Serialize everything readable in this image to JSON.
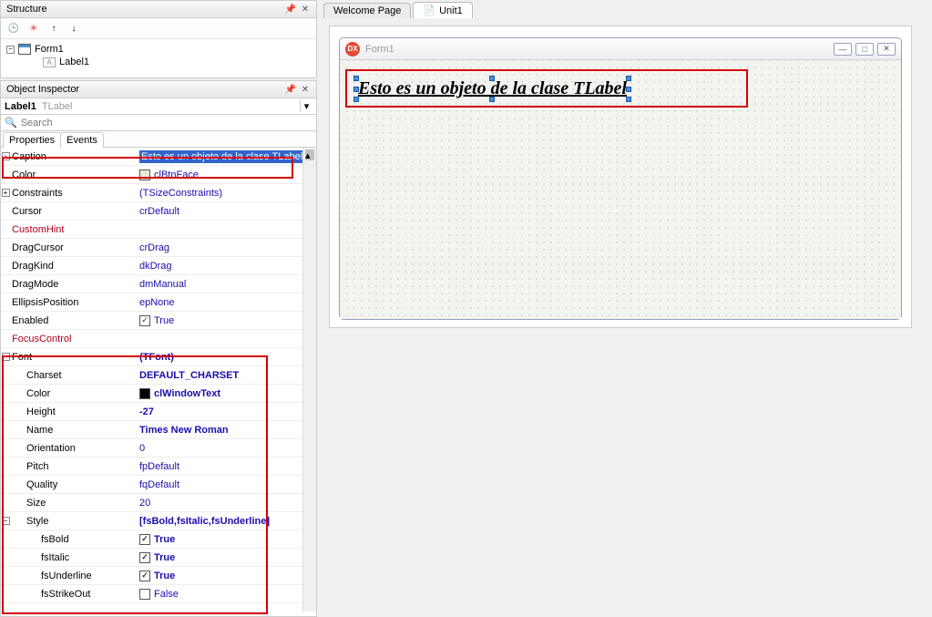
{
  "structure": {
    "title": "Structure",
    "toolbar_icons": [
      "t-blue",
      "x-red",
      "arrow-up",
      "arrow-down"
    ],
    "tree": {
      "form": "Form1",
      "label": "Label1"
    }
  },
  "inspector": {
    "title": "Object Inspector",
    "obj_name": "Label1",
    "obj_type": "TLabel",
    "search_placeholder": "Search",
    "tabs": [
      "Properties",
      "Events"
    ],
    "props": [
      {
        "indent": 0,
        "expand": ">",
        "name": "Caption",
        "value": "Esto es un objeto de la clase TLabel",
        "selected": true
      },
      {
        "indent": 0,
        "name": "Color",
        "value": "clBtnFace",
        "swatch": "#ece9d8"
      },
      {
        "indent": 0,
        "expand": "+",
        "name": "Constraints",
        "value": "(TSizeConstraints)"
      },
      {
        "indent": 0,
        "name": "Cursor",
        "value": "crDefault"
      },
      {
        "indent": 0,
        "name": "CustomHint",
        "value": "",
        "red": true
      },
      {
        "indent": 0,
        "name": "DragCursor",
        "value": "crDrag"
      },
      {
        "indent": 0,
        "name": "DragKind",
        "value": "dkDrag"
      },
      {
        "indent": 0,
        "name": "DragMode",
        "value": "dmManual"
      },
      {
        "indent": 0,
        "name": "EllipsisPosition",
        "value": "epNone"
      },
      {
        "indent": 0,
        "name": "Enabled",
        "value": "True",
        "check": true
      },
      {
        "indent": 0,
        "name": "FocusControl",
        "value": "",
        "red": true
      },
      {
        "indent": 0,
        "expand": "-",
        "name": "Font",
        "value": "(TFont)",
        "bold": true
      },
      {
        "indent": 1,
        "name": "Charset",
        "value": "DEFAULT_CHARSET",
        "bold": true
      },
      {
        "indent": 1,
        "name": "Color",
        "value": "clWindowText",
        "swatch": "#000000",
        "bold": true
      },
      {
        "indent": 1,
        "name": "Height",
        "value": "-27",
        "bold": true
      },
      {
        "indent": 1,
        "name": "Name",
        "value": "Times New Roman",
        "bold": true
      },
      {
        "indent": 1,
        "name": "Orientation",
        "value": "0"
      },
      {
        "indent": 1,
        "name": "Pitch",
        "value": "fpDefault"
      },
      {
        "indent": 1,
        "name": "Quality",
        "value": "fqDefault"
      },
      {
        "indent": 1,
        "name": "Size",
        "value": "20"
      },
      {
        "indent": 1,
        "expand": "-",
        "name": "Style",
        "value": "[fsBold,fsItalic,fsUnderline]",
        "bold": true
      },
      {
        "indent": 2,
        "name": "fsBold",
        "value": "True",
        "check": true,
        "bold": true
      },
      {
        "indent": 2,
        "name": "fsItalic",
        "value": "True",
        "check": true,
        "bold": true
      },
      {
        "indent": 2,
        "name": "fsUnderline",
        "value": "True",
        "check": true,
        "bold": true
      },
      {
        "indent": 2,
        "name": "fsStrikeOut",
        "value": "False",
        "check": false
      }
    ]
  },
  "editor": {
    "tabs": [
      {
        "label": "Welcome Page",
        "active": false
      },
      {
        "label": "Unit1",
        "active": true
      }
    ],
    "form_title": "Form1",
    "label_text": "Esto es un objeto de la clase TLabel"
  }
}
